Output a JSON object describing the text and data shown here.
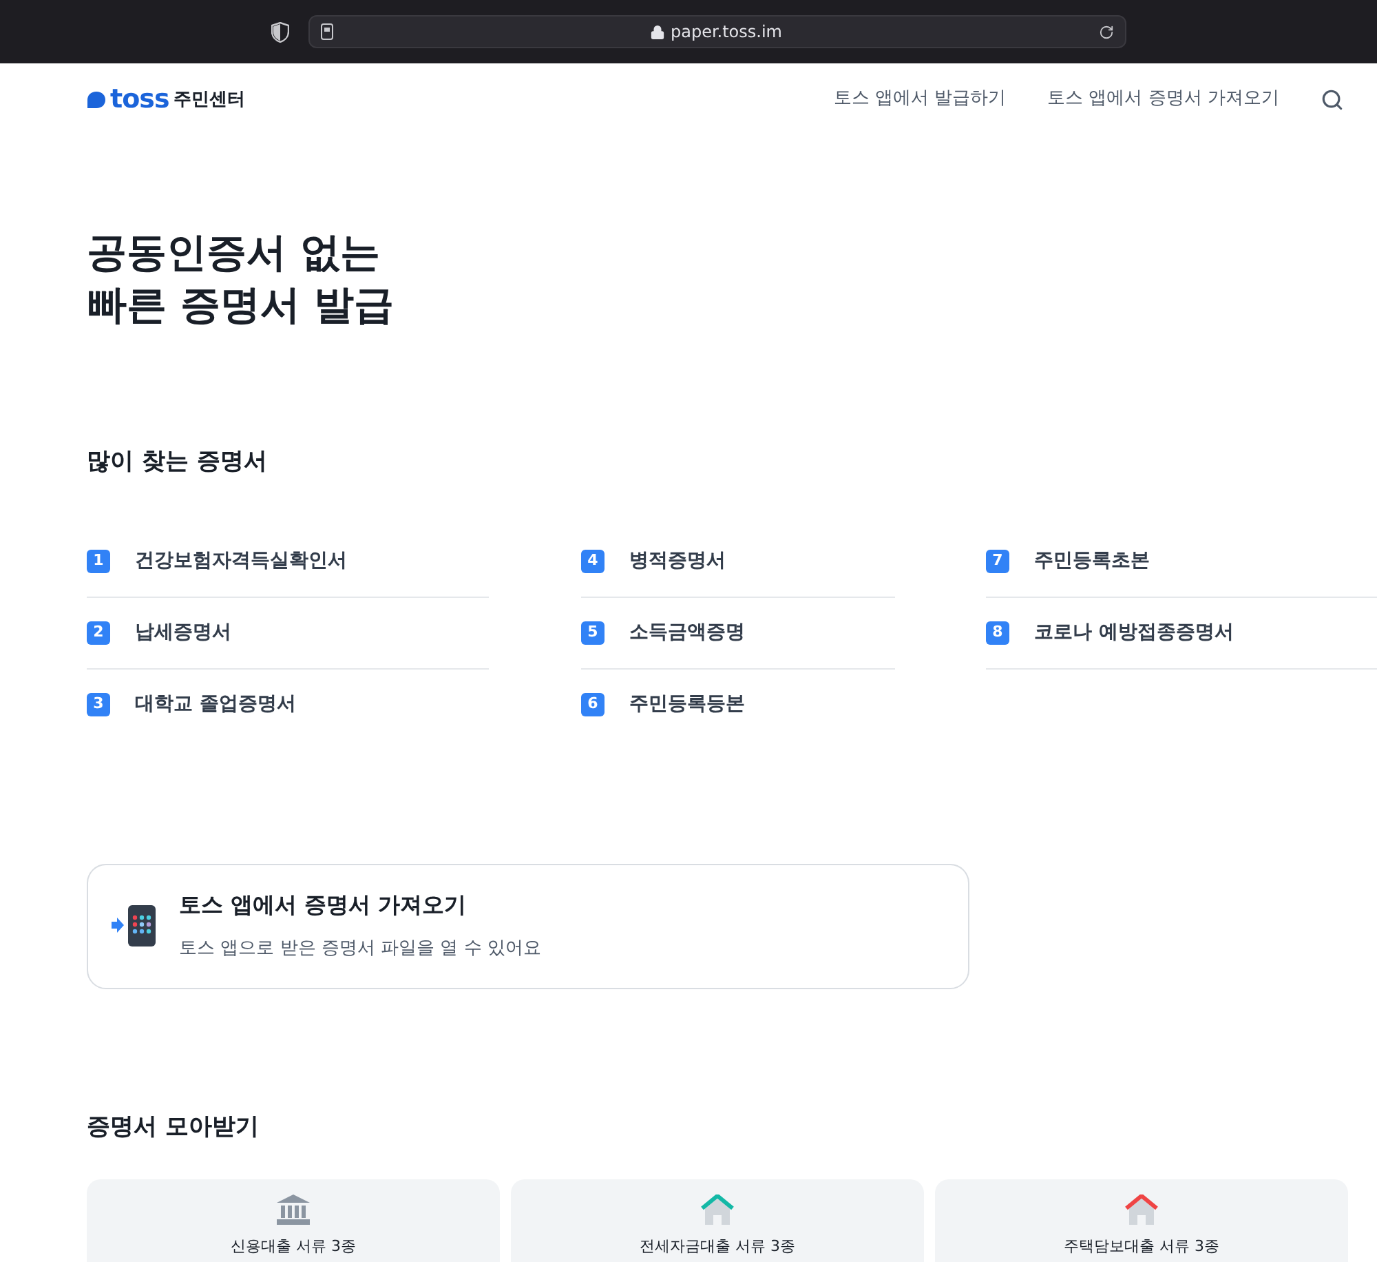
{
  "browser": {
    "url": "paper.toss.im"
  },
  "header": {
    "logo": "toss",
    "logo_suffix": "주민센터",
    "nav": [
      "토스 앱에서 발급하기",
      "토스 앱에서 증명서 가져오기"
    ]
  },
  "hero": {
    "lines": [
      "공동인증서 없는",
      "빠른 증명서 발급"
    ]
  },
  "popular": {
    "title": "많이 찾는 증명서",
    "columns": [
      [
        {
          "number": "1",
          "label": "건강보험자격득실확인서"
        },
        {
          "number": "2",
          "label": "납세증명서"
        },
        {
          "number": "3",
          "label": "대학교 졸업증명서"
        }
      ],
      [
        {
          "number": "4",
          "label": "병적증명서"
        },
        {
          "number": "5",
          "label": "소득금액증명"
        },
        {
          "number": "6",
          "label": "주민등록등본"
        }
      ],
      [
        {
          "number": "7",
          "label": "주민등록초본"
        },
        {
          "number": "8",
          "label": "코로나 예방접종증명서"
        }
      ]
    ]
  },
  "import_card": {
    "title": "토스 앱에서 증명서 가져오기",
    "description": "토스 앱으로 받은 증명서 파일을 열 수 있어요"
  },
  "bundles": {
    "title": "증명서 모아받기",
    "items": [
      {
        "kind": "bank",
        "color": "#8b95a1",
        "label": "신용대출 서류 3종"
      },
      {
        "kind": "house",
        "color": "#14b8a6",
        "label": "전세자금대출 서류 3종"
      },
      {
        "kind": "house",
        "color": "#ef4444",
        "label": "주택담보대출 서류 3종"
      }
    ]
  }
}
